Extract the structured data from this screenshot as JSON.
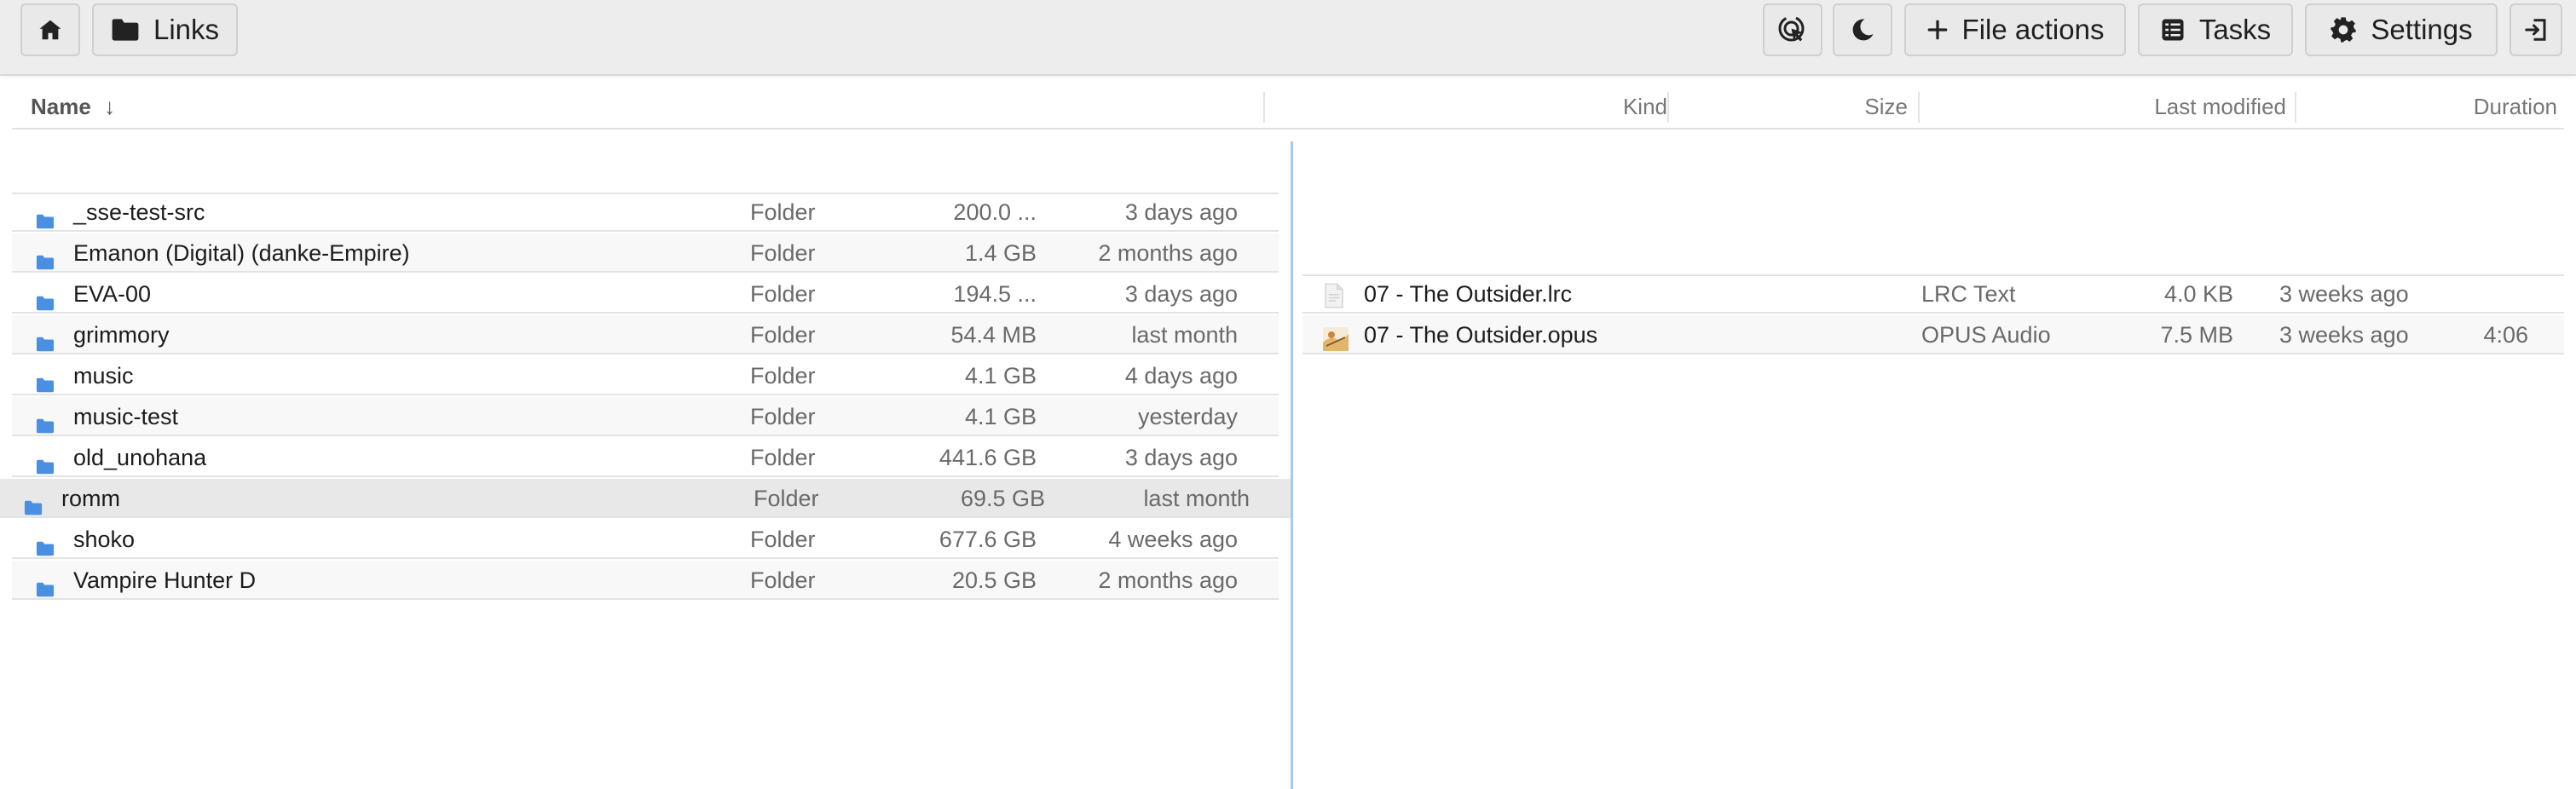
{
  "toolbar": {
    "home_icon": "home-icon",
    "links_label": "Links",
    "file_actions_label": "File actions",
    "tasks_label": "Tasks",
    "settings_label": "Settings"
  },
  "columns": {
    "name": "Name",
    "kind": "Kind",
    "size": "Size",
    "modified": "Last modified",
    "duration": "Duration"
  },
  "left_pane": {
    "rows": [
      {
        "name": "_sse-test-src",
        "kind": "Folder",
        "size": "200.0 ...",
        "modified": "3 days ago"
      },
      {
        "name": "Emanon (Digital) (danke-Empire)",
        "kind": "Folder",
        "size": "1.4 GB",
        "modified": "2 months ago"
      },
      {
        "name": "EVA-00",
        "kind": "Folder",
        "size": "194.5 ...",
        "modified": "3 days ago"
      },
      {
        "name": "grimmory",
        "kind": "Folder",
        "size": "54.4 MB",
        "modified": "last month"
      },
      {
        "name": "music",
        "kind": "Folder",
        "size": "4.1 GB",
        "modified": "4 days ago"
      },
      {
        "name": "music-test",
        "kind": "Folder",
        "size": "4.1 GB",
        "modified": "yesterday"
      },
      {
        "name": "old_unohana",
        "kind": "Folder",
        "size": "441.6 GB",
        "modified": "3 days ago"
      },
      {
        "name": "romm",
        "kind": "Folder",
        "size": "69.5 GB",
        "modified": "last month"
      },
      {
        "name": "shoko",
        "kind": "Folder",
        "size": "677.6 GB",
        "modified": "4 weeks ago"
      },
      {
        "name": "Vampire Hunter D",
        "kind": "Folder",
        "size": "20.5 GB",
        "modified": "2 months ago"
      }
    ]
  },
  "right_pane": {
    "rows": [
      {
        "name": "07 - The Outsider.lrc",
        "kind": "LRC Text",
        "size": "4.0 KB",
        "modified": "3 weeks ago",
        "duration": ""
      },
      {
        "name": "07 - The Outsider.opus",
        "kind": "OPUS Audio",
        "size": "7.5 MB",
        "modified": "3 weeks ago",
        "duration": "4:06"
      }
    ]
  },
  "colors": {
    "folder": "#4a90e2",
    "accent_divider": "#a9c9ea"
  }
}
